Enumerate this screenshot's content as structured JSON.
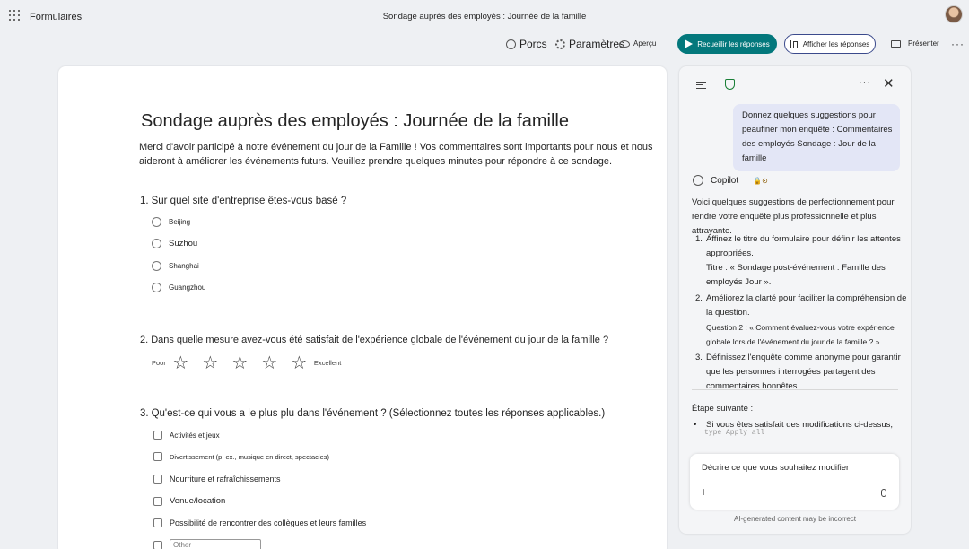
{
  "app": {
    "name": "Formulaires",
    "doc_title": "Sondage auprès des employés : Journée de la famille"
  },
  "toolbar": {
    "porcs": "Porcs",
    "settings": "Paramètres",
    "preview": "Aperçu",
    "collect": "Recueillir les réponses",
    "view_responses": "Afficher les réponses",
    "present": "Présenter",
    "more": "···"
  },
  "form": {
    "title": "Sondage auprès des employés : Journée de la famille",
    "description": "Merci d'avoir participé à notre événement du jour de la Famille ! Vos commentaires sont importants pour nous et nous aideront à améliorer les événements futurs. Veuillez prendre quelques minutes pour répondre à ce sondage.",
    "q1": {
      "num": "1.",
      "text": "Sur quel site d'entreprise êtes-vous basé ?",
      "options": [
        "Beijing",
        "Suzhou",
        "Shanghai",
        "Guangzhou"
      ]
    },
    "q2": {
      "num": "2.",
      "text": "Dans quelle mesure avez-vous été satisfait de l'expérience globale de l'événement du jour de la famille ?",
      "low": "Poor",
      "high": "Excellent",
      "stars": [
        "☆",
        "☆",
        "☆",
        "☆",
        "☆"
      ]
    },
    "q3": {
      "num": "3.",
      "text": "Qu'est-ce qui vous a le plus plu dans l'événement ? (Sélectionnez toutes les réponses applicables.)",
      "options": [
        "Activités et jeux",
        "Divertissement (p. ex., musique en direct, spectacles)",
        "Nourriture et rafraîchissements",
        "Venue/location",
        "Possibilité de rencontrer des collègues et leurs familles"
      ],
      "other_placeholder": "Other"
    }
  },
  "copilot": {
    "more": "···",
    "close": "✕",
    "user_message": "Donnez quelques suggestions pour peaufiner mon enquête : Commentaires des employés Sondage : Jour de la famille",
    "name": "Copilot",
    "badge": "🔒⊙",
    "intro": "Voici quelques suggestions de perfectionnement pour rendre votre enquête plus professionnelle et plus attrayante.",
    "items": [
      {
        "n": "1.",
        "main": "Affinez le titre du formulaire pour définir les attentes appropriées.",
        "detail": "Titre : « Sondage post-événement : Famille des employés Jour »."
      },
      {
        "n": "2.",
        "main": "Améliorez la clarté pour faciliter la compréhension de la question.",
        "detail": "Question 2 : « Comment évaluez-vous votre expérience globale lors de l'événement du jour de la famille ? »"
      },
      {
        "n": "3.",
        "main": "Définissez l'enquête comme anonyme pour garantir que les personnes interrogées partagent des commentaires honnêtes.",
        "detail": ""
      }
    ],
    "next_step": "Étape suivante :",
    "next_bullet": "Si vous êtes satisfait des modifications ci-dessus,",
    "faded": "type Apply all",
    "input_placeholder": "Décrire ce que vous souhaitez modifier",
    "disclaimer": "AI-generated content may be incorrect"
  }
}
